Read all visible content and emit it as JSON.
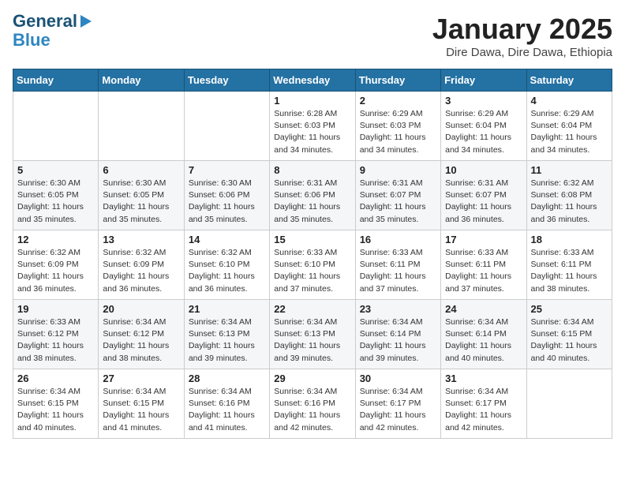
{
  "logo": {
    "general": "General",
    "blue": "Blue"
  },
  "header": {
    "title": "January 2025",
    "subtitle": "Dire Dawa, Dire Dawa, Ethiopia"
  },
  "weekdays": [
    "Sunday",
    "Monday",
    "Tuesday",
    "Wednesday",
    "Thursday",
    "Friday",
    "Saturday"
  ],
  "weeks": [
    [
      {
        "day": "",
        "info": ""
      },
      {
        "day": "",
        "info": ""
      },
      {
        "day": "",
        "info": ""
      },
      {
        "day": "1",
        "info": "Sunrise: 6:28 AM\nSunset: 6:03 PM\nDaylight: 11 hours\nand 34 minutes."
      },
      {
        "day": "2",
        "info": "Sunrise: 6:29 AM\nSunset: 6:03 PM\nDaylight: 11 hours\nand 34 minutes."
      },
      {
        "day": "3",
        "info": "Sunrise: 6:29 AM\nSunset: 6:04 PM\nDaylight: 11 hours\nand 34 minutes."
      },
      {
        "day": "4",
        "info": "Sunrise: 6:29 AM\nSunset: 6:04 PM\nDaylight: 11 hours\nand 34 minutes."
      }
    ],
    [
      {
        "day": "5",
        "info": "Sunrise: 6:30 AM\nSunset: 6:05 PM\nDaylight: 11 hours\nand 35 minutes."
      },
      {
        "day": "6",
        "info": "Sunrise: 6:30 AM\nSunset: 6:05 PM\nDaylight: 11 hours\nand 35 minutes."
      },
      {
        "day": "7",
        "info": "Sunrise: 6:30 AM\nSunset: 6:06 PM\nDaylight: 11 hours\nand 35 minutes."
      },
      {
        "day": "8",
        "info": "Sunrise: 6:31 AM\nSunset: 6:06 PM\nDaylight: 11 hours\nand 35 minutes."
      },
      {
        "day": "9",
        "info": "Sunrise: 6:31 AM\nSunset: 6:07 PM\nDaylight: 11 hours\nand 35 minutes."
      },
      {
        "day": "10",
        "info": "Sunrise: 6:31 AM\nSunset: 6:07 PM\nDaylight: 11 hours\nand 36 minutes."
      },
      {
        "day": "11",
        "info": "Sunrise: 6:32 AM\nSunset: 6:08 PM\nDaylight: 11 hours\nand 36 minutes."
      }
    ],
    [
      {
        "day": "12",
        "info": "Sunrise: 6:32 AM\nSunset: 6:09 PM\nDaylight: 11 hours\nand 36 minutes."
      },
      {
        "day": "13",
        "info": "Sunrise: 6:32 AM\nSunset: 6:09 PM\nDaylight: 11 hours\nand 36 minutes."
      },
      {
        "day": "14",
        "info": "Sunrise: 6:32 AM\nSunset: 6:10 PM\nDaylight: 11 hours\nand 36 minutes."
      },
      {
        "day": "15",
        "info": "Sunrise: 6:33 AM\nSunset: 6:10 PM\nDaylight: 11 hours\nand 37 minutes."
      },
      {
        "day": "16",
        "info": "Sunrise: 6:33 AM\nSunset: 6:11 PM\nDaylight: 11 hours\nand 37 minutes."
      },
      {
        "day": "17",
        "info": "Sunrise: 6:33 AM\nSunset: 6:11 PM\nDaylight: 11 hours\nand 37 minutes."
      },
      {
        "day": "18",
        "info": "Sunrise: 6:33 AM\nSunset: 6:11 PM\nDaylight: 11 hours\nand 38 minutes."
      }
    ],
    [
      {
        "day": "19",
        "info": "Sunrise: 6:33 AM\nSunset: 6:12 PM\nDaylight: 11 hours\nand 38 minutes."
      },
      {
        "day": "20",
        "info": "Sunrise: 6:34 AM\nSunset: 6:12 PM\nDaylight: 11 hours\nand 38 minutes."
      },
      {
        "day": "21",
        "info": "Sunrise: 6:34 AM\nSunset: 6:13 PM\nDaylight: 11 hours\nand 39 minutes."
      },
      {
        "day": "22",
        "info": "Sunrise: 6:34 AM\nSunset: 6:13 PM\nDaylight: 11 hours\nand 39 minutes."
      },
      {
        "day": "23",
        "info": "Sunrise: 6:34 AM\nSunset: 6:14 PM\nDaylight: 11 hours\nand 39 minutes."
      },
      {
        "day": "24",
        "info": "Sunrise: 6:34 AM\nSunset: 6:14 PM\nDaylight: 11 hours\nand 40 minutes."
      },
      {
        "day": "25",
        "info": "Sunrise: 6:34 AM\nSunset: 6:15 PM\nDaylight: 11 hours\nand 40 minutes."
      }
    ],
    [
      {
        "day": "26",
        "info": "Sunrise: 6:34 AM\nSunset: 6:15 PM\nDaylight: 11 hours\nand 40 minutes."
      },
      {
        "day": "27",
        "info": "Sunrise: 6:34 AM\nSunset: 6:15 PM\nDaylight: 11 hours\nand 41 minutes."
      },
      {
        "day": "28",
        "info": "Sunrise: 6:34 AM\nSunset: 6:16 PM\nDaylight: 11 hours\nand 41 minutes."
      },
      {
        "day": "29",
        "info": "Sunrise: 6:34 AM\nSunset: 6:16 PM\nDaylight: 11 hours\nand 42 minutes."
      },
      {
        "day": "30",
        "info": "Sunrise: 6:34 AM\nSunset: 6:17 PM\nDaylight: 11 hours\nand 42 minutes."
      },
      {
        "day": "31",
        "info": "Sunrise: 6:34 AM\nSunset: 6:17 PM\nDaylight: 11 hours\nand 42 minutes."
      },
      {
        "day": "",
        "info": ""
      }
    ]
  ]
}
